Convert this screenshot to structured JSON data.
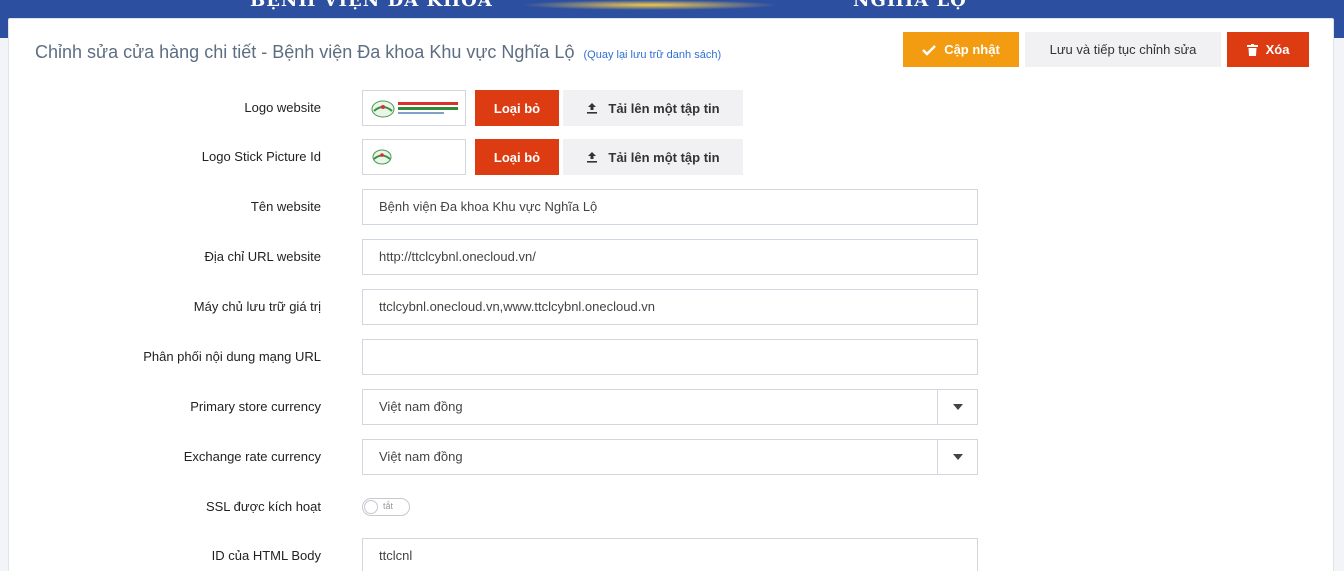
{
  "header": {
    "banner_left": "BỆNH VIỆN ĐA KHOA",
    "banner_right": "NGHĨA LỘ"
  },
  "page": {
    "title": "Chỉnh sửa cửa hàng chi tiết - Bệnh viện Đa khoa Khu vực Nghĩa Lộ",
    "back_link": "(Quay lại lưu trữ danh sách)"
  },
  "toolbar": {
    "update_label": "Cập nhật",
    "save_continue_label": "Lưu và tiếp tục chỉnh sửa",
    "delete_label": "Xóa"
  },
  "colors": {
    "update": "#f39c12",
    "delete": "#dd3b12",
    "topbar": "#2d4fa0"
  },
  "form": {
    "logo_website": {
      "label": "Logo website",
      "remove_label": "Loại bỏ",
      "upload_label": "Tải lên một tập tin"
    },
    "logo_stick": {
      "label": "Logo Stick Picture Id",
      "remove_label": "Loại bỏ",
      "upload_label": "Tải lên một tập tin"
    },
    "site_name": {
      "label": "Tên website",
      "value": "Bệnh viện Đa khoa Khu vực Nghĩa Lộ"
    },
    "site_url": {
      "label": "Địa chỉ URL website",
      "value": "http://ttclcybnl.onecloud.vn/"
    },
    "hosts": {
      "label": "Máy chủ lưu trữ giá trị",
      "value": "ttclcybnl.onecloud.vn,www.ttclcybnl.onecloud.vn"
    },
    "cdn_url": {
      "label": "Phân phối nội dung mạng URL",
      "value": ""
    },
    "primary_currency": {
      "label": "Primary store currency",
      "value": "Việt nam đồng"
    },
    "exchange_currency": {
      "label": "Exchange rate currency",
      "value": "Việt nam đồng"
    },
    "ssl": {
      "label": "SSL được kích hoạt",
      "state_label": "tắt",
      "enabled": false
    },
    "html_body_id": {
      "label": "ID của HTML Body",
      "value": "ttclcnl"
    }
  }
}
